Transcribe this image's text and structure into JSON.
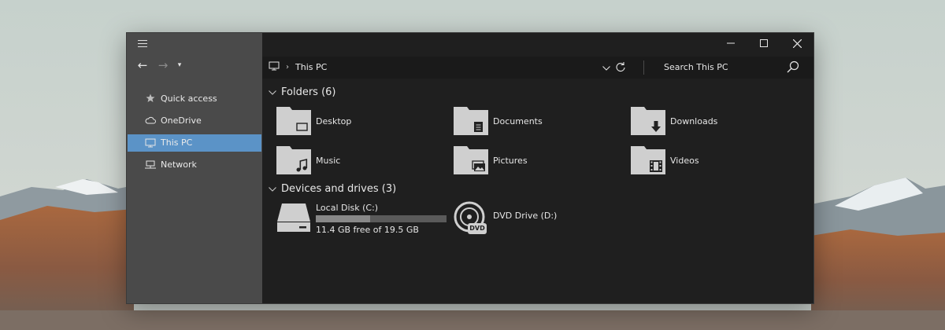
{
  "window": {
    "nav_pane": {
      "items": [
        {
          "label": "Quick access",
          "icon": "star-icon",
          "selected": false
        },
        {
          "label": "OneDrive",
          "icon": "cloud-icon",
          "selected": false
        },
        {
          "label": "This PC",
          "icon": "computer-icon",
          "selected": true
        },
        {
          "label": "Network",
          "icon": "network-icon",
          "selected": false
        }
      ]
    },
    "address": {
      "breadcrumb": "This PC",
      "search_placeholder": "Search This PC"
    },
    "groups": {
      "folders_title": "Folders (6)",
      "drives_title": "Devices and drives (3)"
    },
    "folders": [
      {
        "label": "Desktop",
        "icon": "desktop-icon"
      },
      {
        "label": "Documents",
        "icon": "document-icon"
      },
      {
        "label": "Downloads",
        "icon": "download-arrow-icon"
      },
      {
        "label": "Music",
        "icon": "music-note-icon"
      },
      {
        "label": "Pictures",
        "icon": "pictures-icon"
      },
      {
        "label": "Videos",
        "icon": "film-icon"
      }
    ],
    "drives": [
      {
        "label": "Local Disk (C:)",
        "free_text": "11.4 GB free of 19.5 GB",
        "used_fraction": 0.415
      },
      {
        "label": "DVD Drive (D:)",
        "badge": "DVD"
      }
    ]
  },
  "colors": {
    "selection": "#5b93c7",
    "nav_pane_bg": "#4a4a4a",
    "content_bg": "#1f1f1f",
    "folder": "#cfcfcf"
  }
}
